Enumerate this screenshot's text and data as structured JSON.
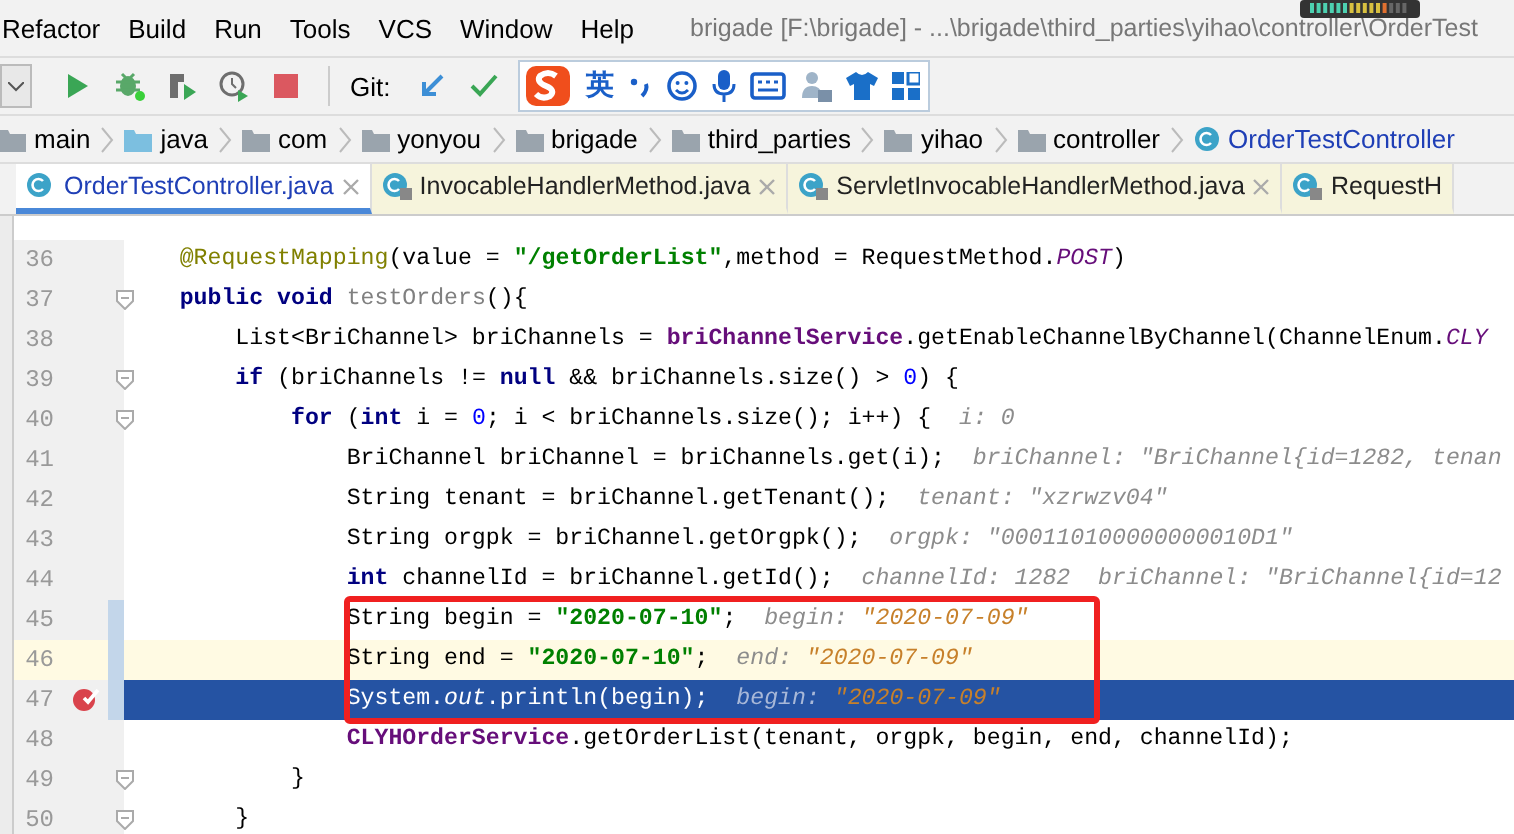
{
  "menu": [
    "Refactor",
    "Build",
    "Run",
    "Tools",
    "VCS",
    "Window",
    "Help"
  ],
  "window": {
    "title": "brigade [F:\\brigade] - ...\\brigade\\third_parties\\yihao\\controller\\OrderTest"
  },
  "toolbar": {
    "vcs_label": "Git:"
  },
  "ime_bar": {
    "language": "英"
  },
  "breadcrumbs": [
    {
      "label": "main",
      "kind": "folder"
    },
    {
      "label": "java",
      "kind": "source-folder"
    },
    {
      "label": "com",
      "kind": "folder"
    },
    {
      "label": "yonyou",
      "kind": "folder"
    },
    {
      "label": "brigade",
      "kind": "folder"
    },
    {
      "label": "third_parties",
      "kind": "folder"
    },
    {
      "label": "yihao",
      "kind": "folder"
    },
    {
      "label": "controller",
      "kind": "folder"
    },
    {
      "label": "OrderTestController",
      "kind": "class"
    }
  ],
  "tabs": [
    {
      "label": "OrderTestController.java",
      "selected": true,
      "locked": false
    },
    {
      "label": "InvocableHandlerMethod.java",
      "selected": false,
      "locked": true
    },
    {
      "label": "ServletInvocableHandlerMethod.java",
      "selected": false,
      "locked": true
    },
    {
      "label": "RequestH",
      "selected": false,
      "locked": true
    }
  ],
  "editor": {
    "lines": [
      {
        "number": "36",
        "selected": false,
        "caret": false,
        "changed": false,
        "breakpoint": false,
        "fold": false,
        "framed": false,
        "tokens": [
          {
            "t": "    @RequestMapping",
            "kind": "ann"
          },
          {
            "t": "(value = ",
            "kind": "plain"
          },
          {
            "t": "\"/getOrderList\"",
            "kind": "str"
          },
          {
            "t": ",method = RequestMethod.",
            "kind": "plain"
          },
          {
            "t": "POST",
            "kind": "static"
          },
          {
            "t": ")",
            "kind": "plain"
          }
        ]
      },
      {
        "number": "37",
        "selected": false,
        "caret": false,
        "changed": false,
        "breakpoint": false,
        "fold": true,
        "framed": false,
        "tokens": [
          {
            "t": "    public void ",
            "kind": "kw"
          },
          {
            "t": "testOrders",
            "kind": "unused"
          },
          {
            "t": "(){",
            "kind": "plain"
          }
        ]
      },
      {
        "number": "38",
        "selected": false,
        "caret": false,
        "changed": false,
        "breakpoint": false,
        "fold": false,
        "framed": false,
        "tokens": [
          {
            "t": "        List<BriChannel> briChannels = ",
            "kind": "plain"
          },
          {
            "t": "briChannelService",
            "kind": "field"
          },
          {
            "t": ".getEnableChannelByChannel(ChannelEnum.",
            "kind": "plain"
          },
          {
            "t": "CLY",
            "kind": "static"
          }
        ]
      },
      {
        "number": "39",
        "selected": false,
        "caret": false,
        "changed": false,
        "breakpoint": false,
        "fold": true,
        "framed": false,
        "tokens": [
          {
            "t": "        if",
            "kind": "kw"
          },
          {
            "t": " (briChannels != ",
            "kind": "plain"
          },
          {
            "t": "null",
            "kind": "kw"
          },
          {
            "t": " && briChannels.size() > ",
            "kind": "plain"
          },
          {
            "t": "0",
            "kind": "num"
          },
          {
            "t": ") {",
            "kind": "plain"
          }
        ]
      },
      {
        "number": "40",
        "selected": false,
        "caret": false,
        "changed": false,
        "breakpoint": false,
        "fold": true,
        "framed": false,
        "tokens": [
          {
            "t": "            for",
            "kind": "kw"
          },
          {
            "t": " (",
            "kind": "plain"
          },
          {
            "t": "int",
            "kind": "kw"
          },
          {
            "t": " i = ",
            "kind": "plain"
          },
          {
            "t": "0",
            "kind": "num"
          },
          {
            "t": "; i < briChannels.size(); i++) {",
            "kind": "plain"
          },
          {
            "t": "  i: 0",
            "kind": "hint"
          }
        ]
      },
      {
        "number": "41",
        "selected": false,
        "caret": false,
        "changed": false,
        "breakpoint": false,
        "fold": false,
        "framed": false,
        "tokens": [
          {
            "t": "                BriChannel briChannel = briChannels.get(i);",
            "kind": "plain"
          },
          {
            "t": "  briChannel: \"BriChannel{id=1282, tenan",
            "kind": "hint"
          }
        ]
      },
      {
        "number": "42",
        "selected": false,
        "caret": false,
        "changed": false,
        "breakpoint": false,
        "fold": false,
        "framed": false,
        "tokens": [
          {
            "t": "                String tenant = briChannel.getTenant();",
            "kind": "plain"
          },
          {
            "t": "  tenant: \"xzrwzv04\"",
            "kind": "hint"
          }
        ]
      },
      {
        "number": "43",
        "selected": false,
        "caret": false,
        "changed": false,
        "breakpoint": false,
        "fold": false,
        "framed": false,
        "tokens": [
          {
            "t": "                String orgpk = briChannel.getOrgpk();",
            "kind": "plain"
          },
          {
            "t": "  orgpk: \"000110100000000010D1\"",
            "kind": "hint"
          }
        ]
      },
      {
        "number": "44",
        "selected": false,
        "caret": false,
        "changed": false,
        "breakpoint": false,
        "fold": false,
        "framed": false,
        "tokens": [
          {
            "t": "                int",
            "kind": "kw"
          },
          {
            "t": " channelId = briChannel.getId();",
            "kind": "plain"
          },
          {
            "t": "  channelId: 1282  briChannel: \"BriChannel{id=12",
            "kind": "hint"
          }
        ]
      },
      {
        "number": "45",
        "selected": false,
        "caret": false,
        "changed": true,
        "breakpoint": false,
        "fold": false,
        "framed": true,
        "tokens": [
          {
            "t": "                String begin = ",
            "kind": "plain"
          },
          {
            "t": "\"2020-07-10\"",
            "kind": "str"
          },
          {
            "t": ";",
            "kind": "plain"
          },
          {
            "t": "  begin: ",
            "kind": "hint"
          },
          {
            "t": "\"2020-07-09\"",
            "kind": "newval"
          }
        ]
      },
      {
        "number": "46",
        "selected": false,
        "caret": true,
        "changed": true,
        "breakpoint": false,
        "fold": false,
        "framed": true,
        "tokens": [
          {
            "t": "                String end = ",
            "kind": "plain"
          },
          {
            "t": "\"2020-07-10\"",
            "kind": "str"
          },
          {
            "t": ";",
            "kind": "plain"
          },
          {
            "t": "  end: ",
            "kind": "hint"
          },
          {
            "t": "\"2020-07-09\"",
            "kind": "newval"
          }
        ]
      },
      {
        "number": "47",
        "selected": true,
        "caret": false,
        "changed": true,
        "breakpoint": true,
        "fold": false,
        "framed": true,
        "tokens": [
          {
            "t": "                System.",
            "kind": "plain"
          },
          {
            "t": "out",
            "kind": "static"
          },
          {
            "t": ".println(begin);",
            "kind": "plain"
          },
          {
            "t": "  begin: ",
            "kind": "hint"
          },
          {
            "t": "\"2020-07-09\"",
            "kind": "newval"
          }
        ]
      },
      {
        "number": "48",
        "selected": false,
        "caret": false,
        "changed": false,
        "breakpoint": false,
        "fold": false,
        "framed": false,
        "tokens": [
          {
            "t": "                CLYHOrderService",
            "kind": "field"
          },
          {
            "t": ".getOrderList(tenant, orgpk, begin, end, channelId);",
            "kind": "plain"
          }
        ]
      },
      {
        "number": "49",
        "selected": false,
        "caret": false,
        "changed": false,
        "breakpoint": false,
        "fold": true,
        "framed": false,
        "tokens": [
          {
            "t": "            }",
            "kind": "plain"
          }
        ]
      },
      {
        "number": "50",
        "selected": false,
        "caret": false,
        "changed": false,
        "breakpoint": false,
        "fold": true,
        "framed": false,
        "tokens": [
          {
            "t": "        }",
            "kind": "plain"
          }
        ]
      }
    ]
  }
}
